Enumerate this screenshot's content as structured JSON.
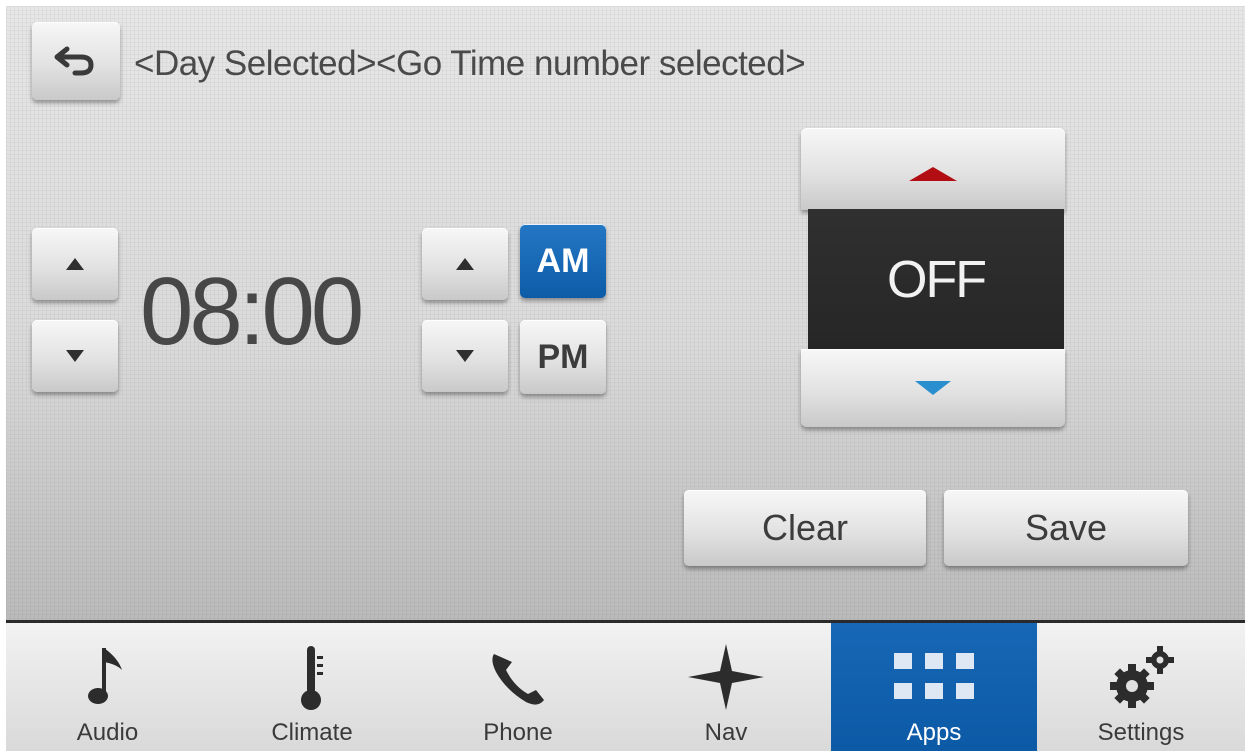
{
  "header": {
    "back_label": "back",
    "title": "<Day Selected><Go Time number selected>"
  },
  "time": {
    "value": "08:00",
    "am_label": "AM",
    "pm_label": "PM",
    "selected_period": "AM"
  },
  "mode": {
    "value": "OFF"
  },
  "actions": {
    "clear_label": "Clear",
    "save_label": "Save"
  },
  "tabs": [
    {
      "label": "Audio",
      "icon": "music-note-icon"
    },
    {
      "label": "Climate",
      "icon": "thermometer-icon"
    },
    {
      "label": "Phone",
      "icon": "phone-icon"
    },
    {
      "label": "Nav",
      "icon": "compass-star-icon"
    },
    {
      "label": "Apps",
      "icon": "apps-grid-icon",
      "active": true
    },
    {
      "label": "Settings",
      "icon": "gears-icon"
    }
  ],
  "colors": {
    "accent": "#0c5aa6",
    "up_arrow_red": "#b10d12",
    "down_arrow_blue": "#2a8fcf"
  }
}
